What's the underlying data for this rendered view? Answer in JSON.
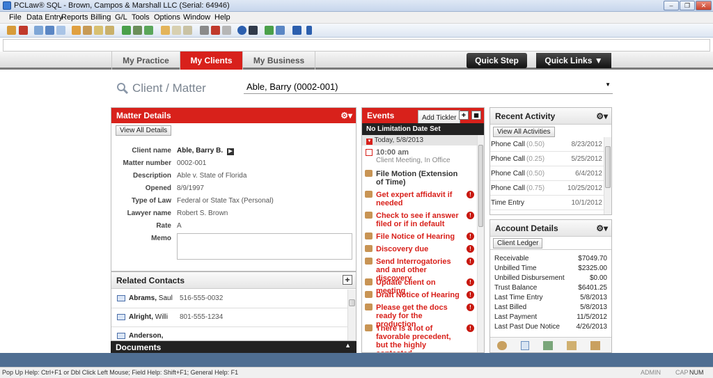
{
  "window": {
    "title": "PCLaw® SQL - Brown, Campos & Marshall LLC (Serial:  64946)"
  },
  "menu": [
    "File",
    "Data Entry",
    "Reports",
    "Billing",
    "G/L",
    "Tools",
    "Options",
    "Window",
    "Help"
  ],
  "nav": {
    "tabs": [
      "My Practice",
      "My Clients",
      "My Business"
    ],
    "active": "My Clients",
    "quick_step": "Quick Step",
    "quick_links": "Quick Links"
  },
  "client_matter": {
    "label": "Client / Matter",
    "selected": "Able, Barry (0002-001)"
  },
  "matter_details": {
    "title": "Matter Details",
    "view_all": "View All Details",
    "fields": [
      {
        "label": "Client name",
        "value": "Able, Barry B."
      },
      {
        "label": "Matter number",
        "value": "0002-001"
      },
      {
        "label": "Description",
        "value": "Able v. State of Florida"
      },
      {
        "label": "Opened",
        "value": "8/9/1997"
      },
      {
        "label": "Type of Law",
        "value": "Federal or State Tax (Personal)"
      },
      {
        "label": "Lawyer name",
        "value": "Robert S. Brown"
      },
      {
        "label": "Rate",
        "value": "A"
      },
      {
        "label": "Memo",
        "value": ""
      }
    ]
  },
  "related_contacts": {
    "title": "Related Contacts",
    "items": [
      {
        "name": "Abrams,",
        "first": "Saul",
        "phone": "516-555-0032"
      },
      {
        "name": "Alright,",
        "first": "Willi",
        "phone": "801-555-1234"
      },
      {
        "name": "Anderson,",
        "first": "",
        "phone": ""
      }
    ]
  },
  "documents": {
    "title": "Documents"
  },
  "events": {
    "title": "Events",
    "add_tickler": "Add Tickler",
    "no_limitation": "No Limitation Date Set",
    "today": "Today, 5/8/2013",
    "appointment": {
      "time": "10:00 am",
      "desc": "Client Meeting, In Office"
    },
    "items": [
      {
        "text": "File Motion (Extension of Time)",
        "alert": false
      },
      {
        "text": "Get expert affidavit if needed",
        "alert": true
      },
      {
        "text": "Check to see if answer filed or if in default",
        "alert": true
      },
      {
        "text": "File Notice of Hearing",
        "alert": true
      },
      {
        "text": "Discovery due",
        "alert": true
      },
      {
        "text": "Send Interrogatories and and other discovery",
        "alert": true
      },
      {
        "text": "Update client on meeting",
        "alert": true
      },
      {
        "text": "Draft Notice of Hearing",
        "alert": true
      },
      {
        "text": "Please get the docs ready for the production",
        "alert": true
      },
      {
        "text": "There is a lot of favorable precedent, but the highly contested",
        "alert": true
      }
    ]
  },
  "recent_activity": {
    "title": "Recent Activity",
    "view_all": "View All Activities",
    "items": [
      {
        "type": "Phone Call",
        "hours": "(0.50)",
        "date": "8/23/2012"
      },
      {
        "type": "Phone Call",
        "hours": "(0.25)",
        "date": "5/25/2012"
      },
      {
        "type": "Phone Call",
        "hours": "(0.50)",
        "date": "6/4/2012"
      },
      {
        "type": "Phone Call",
        "hours": "(0.75)",
        "date": "10/25/2012"
      },
      {
        "type": "Time Entry",
        "hours": "",
        "date": "10/1/2012"
      }
    ]
  },
  "account_details": {
    "title": "Account Details",
    "tab": "Client Ledger",
    "rows": [
      {
        "label": "Receivable",
        "value": "$7049.70"
      },
      {
        "label": "Unbilled Time",
        "value": "$2325.00"
      },
      {
        "label": "Unbilled Disbursement",
        "value": "$0.00"
      },
      {
        "label": "Trust Balance",
        "value": "$6401.25"
      },
      {
        "label": "Last Time Entry",
        "value": "5/8/2013"
      },
      {
        "label": "Last Billed",
        "value": "5/8/2013"
      },
      {
        "label": "Last Payment",
        "value": "11/5/2012"
      },
      {
        "label": "Last Past Due Notice",
        "value": "4/26/2013"
      }
    ]
  },
  "status": {
    "help": "Pop Up Help: Ctrl+F1 or Dbl Click Left Mouse; Field Help: Shift+F1; General Help: F1",
    "user": "ADMIN",
    "cap": "CAP",
    "num": "NUM"
  }
}
